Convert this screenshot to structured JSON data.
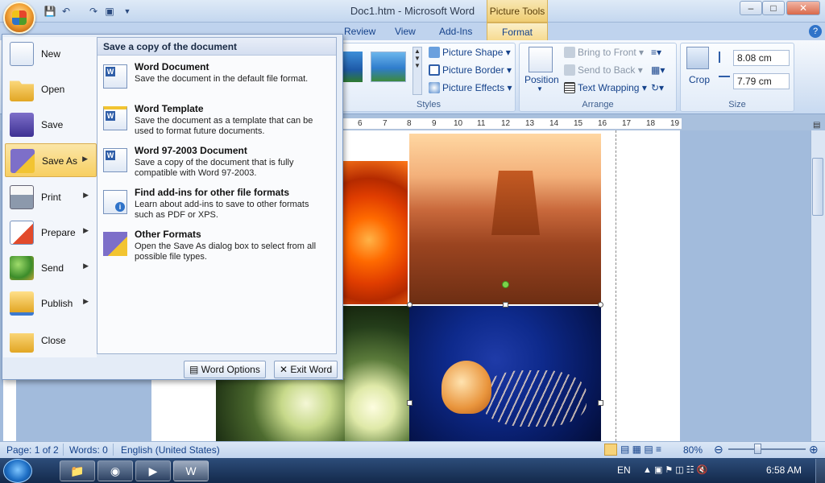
{
  "window": {
    "title": "Doc1.htm - Microsoft Word",
    "context_tab_group": "Picture Tools",
    "controls": [
      "–",
      "□",
      "✕"
    ]
  },
  "ribbon": {
    "tabs": [
      "Review",
      "View",
      "Add-Ins",
      "Format"
    ],
    "active_tab": "Format",
    "styles_group_label": "Styles",
    "picture_shape": "Picture Shape",
    "picture_border": "Picture Border",
    "picture_effects": "Picture Effects",
    "position": "Position",
    "bring_to_front": "Bring to Front",
    "send_to_back": "Send to Back",
    "text_wrapping": "Text Wrapping",
    "arrange_group_label": "Arrange",
    "crop": "Crop",
    "height_value": "8.08 cm",
    "width_value": "7.79 cm",
    "size_group_label": "Size"
  },
  "ruler": {
    "ticks": [
      "6",
      "7",
      "8",
      "9",
      "10",
      "11",
      "12",
      "13",
      "14",
      "15",
      "16",
      "17",
      "18",
      "19"
    ]
  },
  "office_menu": {
    "items": [
      {
        "label": "New",
        "hotkey_char": "N",
        "has_arrow": false
      },
      {
        "label": "Open",
        "hotkey_char": "O",
        "has_arrow": false
      },
      {
        "label": "Save",
        "hotkey_char": "S",
        "has_arrow": false
      },
      {
        "label": "Save As",
        "hotkey_char": "A",
        "has_arrow": true
      },
      {
        "label": "Print",
        "hotkey_char": "P",
        "has_arrow": true
      },
      {
        "label": "Prepare",
        "hotkey_char": "E",
        "has_arrow": true
      },
      {
        "label": "Send",
        "hotkey_char": "D",
        "has_arrow": true
      },
      {
        "label": "Publish",
        "hotkey_char": "U",
        "has_arrow": true
      },
      {
        "label": "Close",
        "hotkey_char": "C",
        "has_arrow": false
      }
    ],
    "selected_item": "Save As",
    "submenu_title": "Save a copy of the document",
    "submenu_items": [
      {
        "title": "Word Document",
        "desc": "Save the document in the default file format."
      },
      {
        "title": "Word Template",
        "desc": "Save the document as a template that can be used to format future documents."
      },
      {
        "title": "Word 97-2003 Document",
        "desc": "Save a copy of the document that is fully compatible with Word 97-2003."
      },
      {
        "title": "Find add-ins for other file formats",
        "desc": "Learn about add-ins to save to other formats such as PDF or XPS."
      },
      {
        "title": "Other Formats",
        "desc": "Open the Save As dialog box to select from all possible file types."
      }
    ],
    "word_options": "Word Options",
    "exit_word": "Exit Word"
  },
  "status_bar": {
    "page": "Page: 1 of 2",
    "words": "Words: 0",
    "language": "English (United States)",
    "zoom": "80%"
  },
  "taskbar": {
    "language": "EN",
    "clock": "6:58 AM"
  },
  "colors": {
    "ribbon_tab_active": "#f6d98c",
    "menu_highlight": "#f7cf62",
    "taskbar": "#13294b"
  }
}
